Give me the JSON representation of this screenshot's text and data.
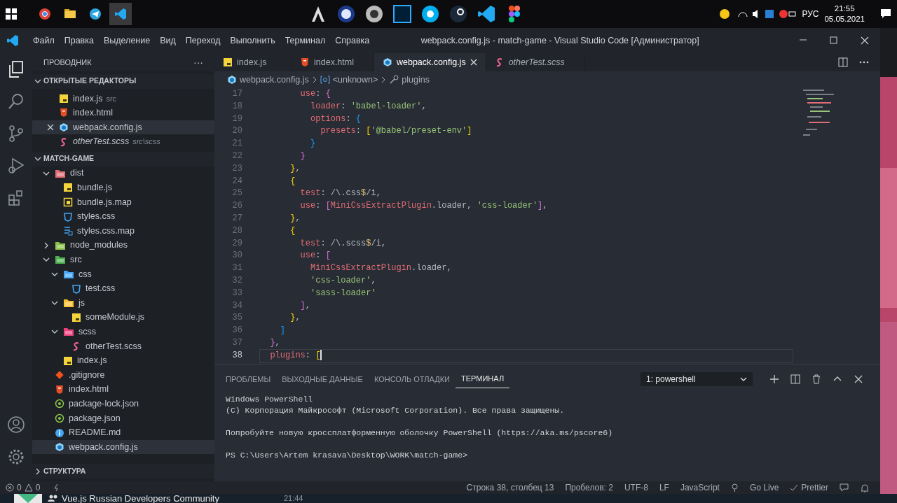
{
  "taskbar": {
    "pinned_apps": [
      {
        "kind": "browser",
        "selected": false
      },
      {
        "kind": "folder",
        "selected": false
      },
      {
        "kind": "plane",
        "selected": false
      },
      {
        "kind": "editor",
        "selected": true
      }
    ],
    "tray": {
      "language": "РУС",
      "time": "21:55",
      "date": "05.05.2021"
    }
  },
  "window": {
    "menu": [
      "Файл",
      "Правка",
      "Выделение",
      "Вид",
      "Переход",
      "Выполнить",
      "Терминал",
      "Справка"
    ],
    "title": "webpack.config.js - match-game - Visual Studio Code [Администратор]"
  },
  "sidebar": {
    "title": "ПРОВОДНИК",
    "more": "···",
    "open_editors": {
      "title": "ОТКРЫТЫЕ РЕДАКТОРЫ",
      "expanded": true,
      "items": [
        {
          "name": "index.js",
          "description": "src",
          "kind": "js",
          "preview": false,
          "selected": false
        },
        {
          "name": "index.html",
          "kind": "html",
          "preview": false,
          "selected": false
        },
        {
          "name": "webpack.config.js",
          "kind": "webpack",
          "preview": false,
          "selected": true
        },
        {
          "name": "otherTest.scss",
          "description": "src\\scss",
          "kind": "scss",
          "preview": true,
          "selected": false
        }
      ]
    },
    "project": {
      "title": "MATCH-GAME",
      "expanded": true,
      "tree": [
        {
          "name": "dist",
          "kind": "folder",
          "color": "#e06c75",
          "expanded": true,
          "selected": false,
          "children": [
            {
              "name": "bundle.js",
              "kind": "js",
              "selected": false
            },
            {
              "name": "bundle.js.map",
              "kind": "jsmap",
              "selected": false
            },
            {
              "name": "styles.css",
              "kind": "css",
              "selected": false
            },
            {
              "name": "styles.css.map",
              "kind": "cssmap",
              "selected": false
            }
          ]
        },
        {
          "name": "node_modules",
          "kind": "folder",
          "color": "#8bc34a",
          "expanded": false,
          "selected": false
        },
        {
          "name": "src",
          "kind": "folder",
          "color": "#4caf50",
          "expanded": true,
          "selected": false,
          "children": [
            {
              "name": "css",
              "kind": "folder",
              "color": "#42a5f5",
              "expanded": true,
              "selected": false,
              "children": [
                {
                  "name": "test.css",
                  "kind": "css",
                  "selected": false
                }
              ]
            },
            {
              "name": "js",
              "kind": "folder",
              "color": "#fbc02d",
              "expanded": true,
              "selected": false,
              "children": [
                {
                  "name": "someModule.js",
                  "kind": "js",
                  "selected": false
                }
              ]
            },
            {
              "name": "scss",
              "kind": "folder",
              "color": "#ec407a",
              "expanded": true,
              "selected": false,
              "children": [
                {
                  "name": "otherTest.scss",
                  "kind": "scss",
                  "selected": false
                }
              ]
            },
            {
              "name": "index.js",
              "kind": "js",
              "selected": false
            }
          ]
        },
        {
          "name": ".gitignore",
          "kind": "git",
          "selected": false
        },
        {
          "name": "index.html",
          "kind": "html",
          "selected": false
        },
        {
          "name": "package-lock.json",
          "kind": "json",
          "selected": false
        },
        {
          "name": "package.json",
          "kind": "json",
          "selected": false
        },
        {
          "name": "README.md",
          "kind": "md",
          "selected": false
        },
        {
          "name": "webpack.config.js",
          "kind": "webpack",
          "selected": true
        }
      ]
    },
    "outline": {
      "title": "СТРУКТУРА",
      "expanded": false
    }
  },
  "tabs": [
    {
      "label": "index.js",
      "kind": "js",
      "preview": false,
      "selected": false
    },
    {
      "label": "index.html",
      "kind": "html",
      "preview": false,
      "selected": false
    },
    {
      "label": "webpack.config.js",
      "kind": "webpack",
      "preview": false,
      "selected": true
    },
    {
      "label": "otherTest.scss",
      "kind": "scss",
      "preview": true,
      "selected": false
    }
  ],
  "breadcrumbs": [
    "webpack.config.js",
    "<unknown>",
    "plugins"
  ],
  "code": [
    {
      "number": "17",
      "selected": false,
      "tokens": [
        {
          "kind": "key",
          "text": "        use"
        },
        {
          "kind": "text",
          "text": ": "
        },
        {
          "kind": "b2",
          "text": "{"
        }
      ]
    },
    {
      "number": "18",
      "selected": false,
      "tokens": [
        {
          "kind": "key",
          "text": "          loader"
        },
        {
          "kind": "text",
          "text": ": "
        },
        {
          "kind": "str",
          "text": "'babel-loader'"
        },
        {
          "kind": "text",
          "text": ","
        }
      ]
    },
    {
      "number": "19",
      "selected": false,
      "tokens": [
        {
          "kind": "key",
          "text": "          options"
        },
        {
          "kind": "text",
          "text": ": "
        },
        {
          "kind": "b3",
          "text": "{"
        }
      ]
    },
    {
      "number": "20",
      "selected": false,
      "tokens": [
        {
          "kind": "key",
          "text": "            presets"
        },
        {
          "kind": "text",
          "text": ": "
        },
        {
          "kind": "b1",
          "text": "["
        },
        {
          "kind": "str",
          "text": "'@babel/preset-env'"
        },
        {
          "kind": "b1",
          "text": "]"
        }
      ]
    },
    {
      "number": "21",
      "selected": false,
      "tokens": [
        {
          "kind": "b3",
          "text": "          }"
        }
      ]
    },
    {
      "number": "22",
      "selected": false,
      "tokens": [
        {
          "kind": "b2",
          "text": "        }"
        }
      ]
    },
    {
      "number": "23",
      "selected": false,
      "tokens": [
        {
          "kind": "b1",
          "text": "      }"
        },
        {
          "kind": "text",
          "text": ","
        }
      ]
    },
    {
      "number": "24",
      "selected": false,
      "tokens": [
        {
          "kind": "b1",
          "text": "      {"
        }
      ]
    },
    {
      "number": "25",
      "selected": false,
      "tokens": [
        {
          "kind": "key",
          "text": "        test"
        },
        {
          "kind": "text",
          "text": ": /\\.css"
        },
        {
          "kind": "special",
          "text": "$"
        },
        {
          "kind": "text",
          "text": "/i,"
        }
      ]
    },
    {
      "number": "26",
      "selected": false,
      "tokens": [
        {
          "kind": "key",
          "text": "        use"
        },
        {
          "kind": "text",
          "text": ": "
        },
        {
          "kind": "b2",
          "text": "["
        },
        {
          "kind": "key",
          "text": "MiniCssExtractPlugin"
        },
        {
          "kind": "text",
          "text": ".loader, "
        },
        {
          "kind": "str",
          "text": "'css-loader'"
        },
        {
          "kind": "b2",
          "text": "]"
        },
        {
          "kind": "text",
          "text": ","
        }
      ]
    },
    {
      "number": "27",
      "selected": false,
      "tokens": [
        {
          "kind": "b1",
          "text": "      }"
        },
        {
          "kind": "text",
          "text": ","
        }
      ]
    },
    {
      "number": "28",
      "selected": false,
      "tokens": [
        {
          "kind": "b1",
          "text": "      {"
        }
      ]
    },
    {
      "number": "29",
      "selected": false,
      "tokens": [
        {
          "kind": "key",
          "text": "        test"
        },
        {
          "kind": "text",
          "text": ": /\\.scss"
        },
        {
          "kind": "special",
          "text": "$"
        },
        {
          "kind": "text",
          "text": "/i,"
        }
      ]
    },
    {
      "number": "30",
      "selected": false,
      "tokens": [
        {
          "kind": "key",
          "text": "        use"
        },
        {
          "kind": "text",
          "text": ": "
        },
        {
          "kind": "b2",
          "text": "["
        }
      ]
    },
    {
      "number": "31",
      "selected": false,
      "tokens": [
        {
          "kind": "key",
          "text": "          MiniCssExtractPlugin"
        },
        {
          "kind": "text",
          "text": ".loader,"
        }
      ]
    },
    {
      "number": "32",
      "selected": false,
      "tokens": [
        {
          "kind": "str",
          "text": "          'css-loader'"
        },
        {
          "kind": "text",
          "text": ","
        }
      ]
    },
    {
      "number": "33",
      "selected": false,
      "tokens": [
        {
          "kind": "str",
          "text": "          'sass-loader'"
        }
      ]
    },
    {
      "number": "34",
      "selected": false,
      "tokens": [
        {
          "kind": "b2",
          "text": "        ]"
        },
        {
          "kind": "text",
          "text": ","
        }
      ]
    },
    {
      "number": "35",
      "selected": false,
      "tokens": [
        {
          "kind": "b1",
          "text": "      }"
        },
        {
          "kind": "text",
          "text": ","
        }
      ]
    },
    {
      "number": "36",
      "selected": false,
      "tokens": [
        {
          "kind": "b3",
          "text": "    ]"
        }
      ]
    },
    {
      "number": "37",
      "selected": false,
      "tokens": [
        {
          "kind": "b2",
          "text": "  }"
        },
        {
          "kind": "text",
          "text": ","
        }
      ]
    },
    {
      "number": "38",
      "selected": true,
      "tokens": [
        {
          "kind": "key",
          "text": "  plugins"
        },
        {
          "kind": "text",
          "text": ": "
        },
        {
          "kind": "b1",
          "text": "["
        }
      ]
    }
  ],
  "panel": {
    "tabs": [
      {
        "label": "ПРОБЛЕМЫ",
        "selected": false
      },
      {
        "label": "ВЫХОДНЫЕ ДАННЫЕ",
        "selected": false
      },
      {
        "label": "КОНСОЛЬ ОТЛАДКИ",
        "selected": false
      },
      {
        "label": "ТЕРМИНАЛ",
        "selected": true
      }
    ],
    "terminal_select": "1: powershell",
    "terminal_blocks": [
      [
        "Windows PowerShell",
        "(C) Корпорация Майкрософт (Microsoft Corporation). Все права защищены."
      ],
      [
        "Попробуйте новую кроссплатформенную оболочку PowerShell (https://aka.ms/pscore6)"
      ],
      [
        "PS C:\\Users\\Artem krasava\\Desktop\\WORK\\match-game>"
      ]
    ]
  },
  "status_bar": {
    "errors": "0",
    "warnings": "0",
    "items": [
      "Строка 38, столбец 13",
      "Пробелов: 2",
      "UTF-8",
      "LF",
      "JavaScript",
      "Go Live",
      "Prettier"
    ]
  },
  "background_chat": {
    "title": "Vue.js Russian Developers Community",
    "time": "21:44"
  }
}
